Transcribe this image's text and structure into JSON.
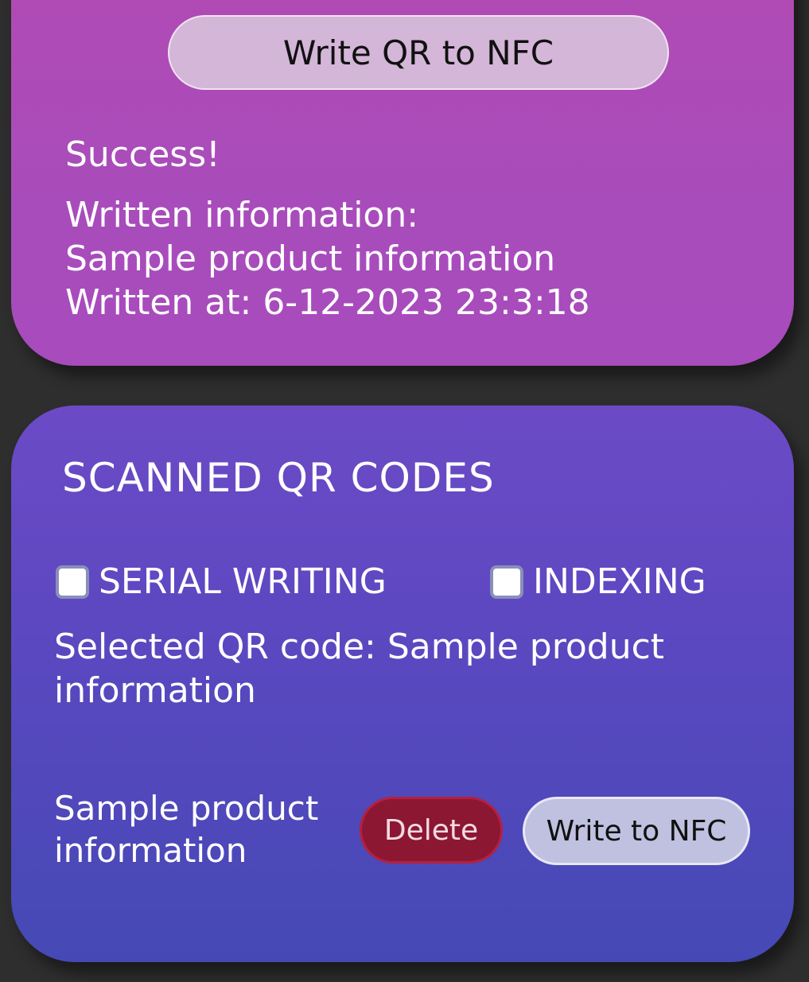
{
  "top_card": {
    "write_qr_button": "Write QR to NFC",
    "status": "Success!",
    "written_info_label": "Written information:",
    "written_info_value": "Sample product information",
    "written_at": "Written at: 6-12-2023 23:3:18"
  },
  "scanned_card": {
    "title": "SCANNED QR CODES",
    "serial_writing_label": "SERIAL WRITING",
    "serial_writing_checked": false,
    "indexing_label": "INDEXING",
    "indexing_checked": false,
    "selected_text": "Selected QR code: Sample product information",
    "items": [
      {
        "label": "Sample product information",
        "delete_label": "Delete",
        "write_label": "Write to NFC"
      }
    ]
  },
  "colors": {
    "background": "#2e2e2e",
    "top_card": "#ab4bba",
    "bottom_card": "#5a48c0",
    "delete_button": "#8c1733",
    "write_button": "#c0c0e0"
  }
}
